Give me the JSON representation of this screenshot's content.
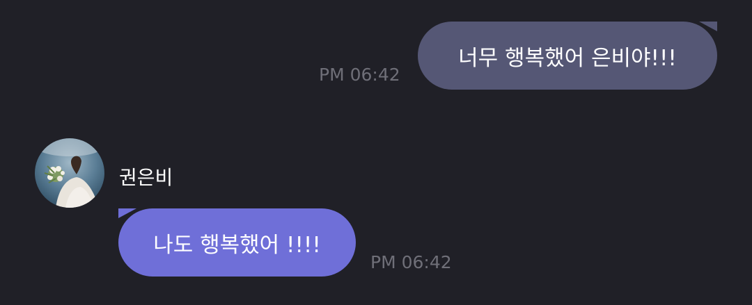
{
  "messages": {
    "sent": {
      "text": "너무 행복했어 은비야!!!",
      "time": "PM 06:42"
    },
    "received": {
      "sender": "권은비",
      "text": "나도 행복했어 !!!!",
      "time": "PM 06:42"
    }
  },
  "colors": {
    "background": "#202027",
    "sent_bubble": "#555775",
    "received_bubble": "#6f6fd8",
    "timestamp": "#6f6f78",
    "text": "#ffffff"
  }
}
